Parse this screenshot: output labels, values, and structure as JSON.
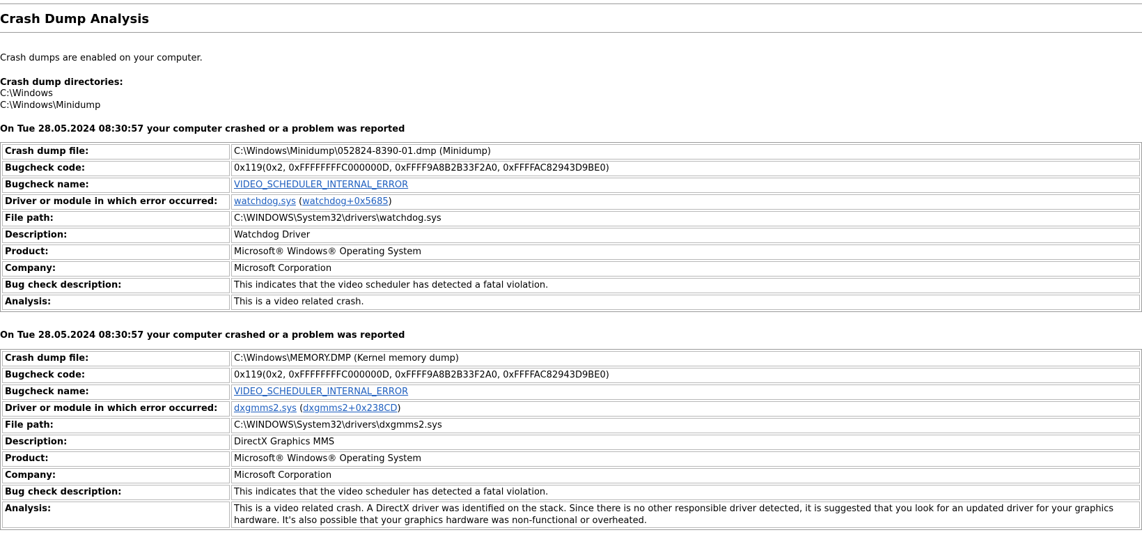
{
  "page": {
    "title": "Crash Dump Analysis",
    "status": "Crash dumps are enabled on your computer.",
    "dirs_heading": "Crash dump directories:",
    "dirs": [
      "C:\\Windows",
      "C:\\Windows\\Minidump"
    ]
  },
  "labels": {
    "file": "Crash dump file:",
    "code": "Bugcheck code:",
    "name": "Bugcheck name:",
    "driver": "Driver or module in which error occurred:",
    "path": "File path:",
    "desc": "Description:",
    "product": "Product:",
    "company": "Company:",
    "bugdesc": "Bug check description:",
    "analysis": "Analysis:"
  },
  "crashes": [
    {
      "heading": "On Tue 28.05.2024 08:30:57 your computer crashed or a problem was reported",
      "file": "C:\\Windows\\Minidump\\052824-8390-01.dmp (Minidump)",
      "code": "0x119(0x2, 0xFFFFFFFFC000000D, 0xFFFF9A8B2B33F2A0, 0xFFFFAC82943D9BE0)",
      "name_link": "VIDEO_SCHEDULER_INTERNAL_ERROR",
      "driver_link": "watchdog.sys",
      "driver_offset_link": "watchdog+0x5685",
      "path": "C:\\WINDOWS\\System32\\drivers\\watchdog.sys",
      "desc": "Watchdog Driver",
      "product": "Microsoft® Windows® Operating System",
      "company": "Microsoft Corporation",
      "bugdesc": "This indicates that the video scheduler has detected a fatal violation.",
      "analysis": "This is a video related crash."
    },
    {
      "heading": "On Tue 28.05.2024 08:30:57 your computer crashed or a problem was reported",
      "file": "C:\\Windows\\MEMORY.DMP (Kernel memory dump)",
      "code": "0x119(0x2, 0xFFFFFFFFC000000D, 0xFFFF9A8B2B33F2A0, 0xFFFFAC82943D9BE0)",
      "name_link": "VIDEO_SCHEDULER_INTERNAL_ERROR",
      "driver_link": "dxgmms2.sys",
      "driver_offset_link": "dxgmms2+0x238CD",
      "path": "C:\\WINDOWS\\System32\\drivers\\dxgmms2.sys",
      "desc": "DirectX Graphics MMS",
      "product": "Microsoft® Windows® Operating System",
      "company": "Microsoft Corporation",
      "bugdesc": "This indicates that the video scheduler has detected a fatal violation.",
      "analysis": "This is a video related crash. A DirectX driver was identified on the stack. Since there is no other responsible driver detected, it is suggested that you look for an updated driver for your graphics hardware. It's also possible that your graphics hardware was non-functional or overheated."
    }
  ]
}
